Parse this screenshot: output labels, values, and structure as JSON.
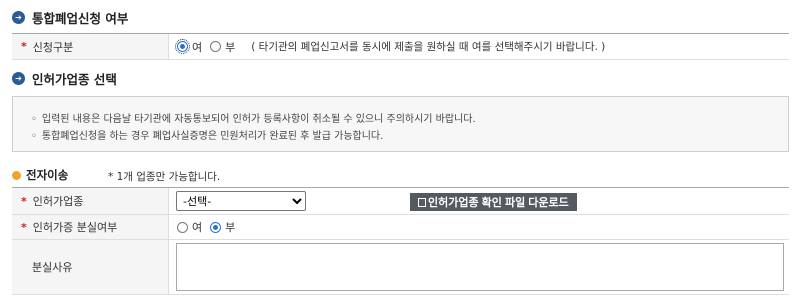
{
  "section1": {
    "title": "통합폐업신청 여부",
    "row": {
      "label": "신청구분",
      "option_yes": "여",
      "option_no": "부",
      "selected": "여",
      "hint": "( 타기관의 폐업신고서를 동시에 제출을 원하실 때 여를 선택해주시기 바랍니다. )"
    }
  },
  "section2": {
    "title": "인허가업종 선택",
    "notices": [
      "입력된 내용은 다음날 타기관에 자동통보되어 인허가 등록사항이 취소될 수 있으니 주의하시기 바랍니다.",
      "통합폐업신청을 하는 경우 폐업사실증명은 민원처리가 완료된 후 발급 가능합니다."
    ],
    "sub_title": "전자이송",
    "sub_note": "* 1개 업종만 가능합니다.",
    "industry": {
      "label": "인허가업종",
      "selected_option": "-선택-",
      "download_label": "인허가업종 확인 파일 다운로드"
    },
    "lost": {
      "label": "인허가증 분실여부",
      "option_yes": "여",
      "option_no": "부",
      "selected": "부"
    },
    "reason": {
      "label": "분실사유",
      "value": ""
    }
  },
  "colors": {
    "section_bullet": "#2a5d93",
    "required_star": "#d01f1f",
    "sub_bullet": "#f0a22c",
    "button_bg": "#555a60",
    "radio_selected": "#2a72d4"
  }
}
